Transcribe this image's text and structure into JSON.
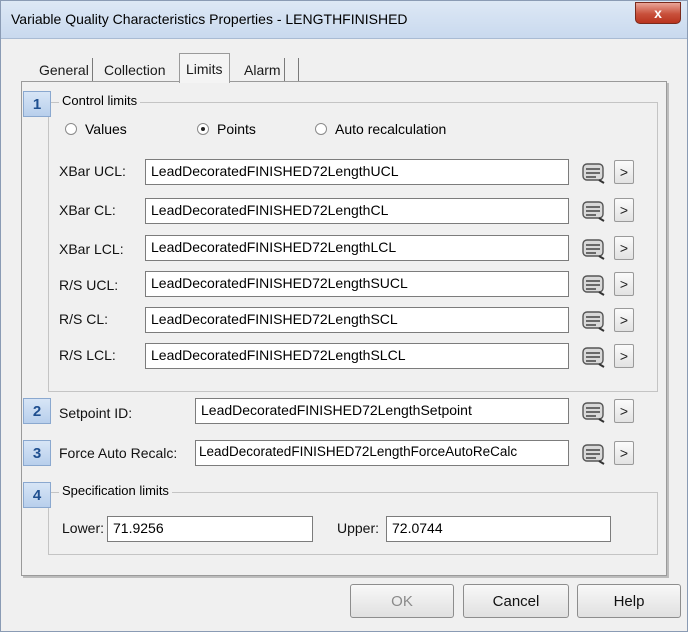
{
  "window": {
    "title": "Variable Quality Characteristics Properties - LENGTHFINISHED",
    "close_label": "x"
  },
  "tabs": [
    {
      "label": "General"
    },
    {
      "label": "Collection"
    },
    {
      "label": "Limits",
      "active": true
    },
    {
      "label": "Alarm"
    }
  ],
  "control_limits": {
    "badge": "1",
    "title": "Control limits",
    "radios": [
      {
        "label": "Values",
        "selected": false
      },
      {
        "label": "Points",
        "selected": true
      },
      {
        "label": "Auto recalculation",
        "selected": false
      }
    ],
    "rows": [
      {
        "label": "XBar UCL:",
        "value": "LeadDecoratedFINISHED72LengthUCL"
      },
      {
        "label": "XBar CL:",
        "value": "LeadDecoratedFINISHED72LengthCL"
      },
      {
        "label": "XBar LCL:",
        "value": "LeadDecoratedFINISHED72LengthLCL"
      },
      {
        "label": "R/S UCL:",
        "value": "LeadDecoratedFINISHED72LengthSUCL"
      },
      {
        "label": "R/S CL:",
        "value": "LeadDecoratedFINISHED72LengthSCL"
      },
      {
        "label": "R/S LCL:",
        "value": "LeadDecoratedFINISHED72LengthSLCL"
      }
    ]
  },
  "setpoint": {
    "badge": "2",
    "label": "Setpoint ID:",
    "value": "LeadDecoratedFINISHED72LengthSetpoint"
  },
  "force_recalc": {
    "badge": "3",
    "label": "Force Auto Recalc:",
    "value": "LeadDecoratedFINISHED72LengthForceAutoReCalc"
  },
  "spec_limits": {
    "badge": "4",
    "title": "Specification limits",
    "lower_label": "Lower:",
    "lower_value": "71.9256",
    "upper_label": "Upper:",
    "upper_value": "72.0744"
  },
  "arrow_glyph": ">",
  "icons": {
    "browse": "tag-browse-icon",
    "arrow": "arrow-right-icon"
  },
  "buttons": {
    "ok": "OK",
    "cancel": "Cancel",
    "help": "Help"
  }
}
